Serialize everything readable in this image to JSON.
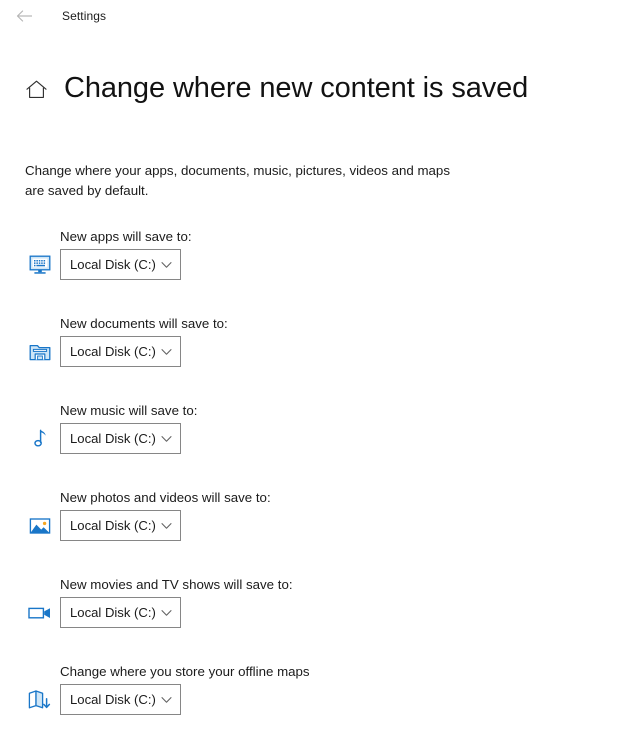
{
  "titlebar": {
    "back_icon": "back-arrow-icon",
    "app_title": "Settings"
  },
  "header": {
    "home_icon": "home-icon",
    "title": "Change where new content is saved"
  },
  "description": "Change where your apps, documents, music, pictures, videos and maps are saved by default.",
  "colors": {
    "accent_blue": "#1976c8",
    "icon_fill_light": "#cfe6f7",
    "combobox_border": "#868686",
    "text": "#1b1b1b",
    "back_arrow": "#b6b6b6"
  },
  "settings": [
    {
      "label": "New apps will save to:",
      "icon": "monitor-apps-icon",
      "value": "Local Disk (C:)",
      "chevron": "chevron-down-icon"
    },
    {
      "label": "New documents will save to:",
      "icon": "folder-documents-icon",
      "value": "Local Disk (C:)",
      "chevron": "chevron-down-icon"
    },
    {
      "label": "New music will save to:",
      "icon": "music-note-icon",
      "value": "Local Disk (C:)",
      "chevron": "chevron-down-icon"
    },
    {
      "label": "New photos and videos will save to:",
      "icon": "photo-picture-icon",
      "value": "Local Disk (C:)",
      "chevron": "chevron-down-icon"
    },
    {
      "label": "New movies and TV shows will save to:",
      "icon": "video-camera-icon",
      "value": "Local Disk (C:)",
      "chevron": "chevron-down-icon"
    },
    {
      "label": "Change where you store your offline maps",
      "icon": "offline-map-download-icon",
      "value": "Local Disk (C:)",
      "chevron": "chevron-down-icon"
    }
  ]
}
